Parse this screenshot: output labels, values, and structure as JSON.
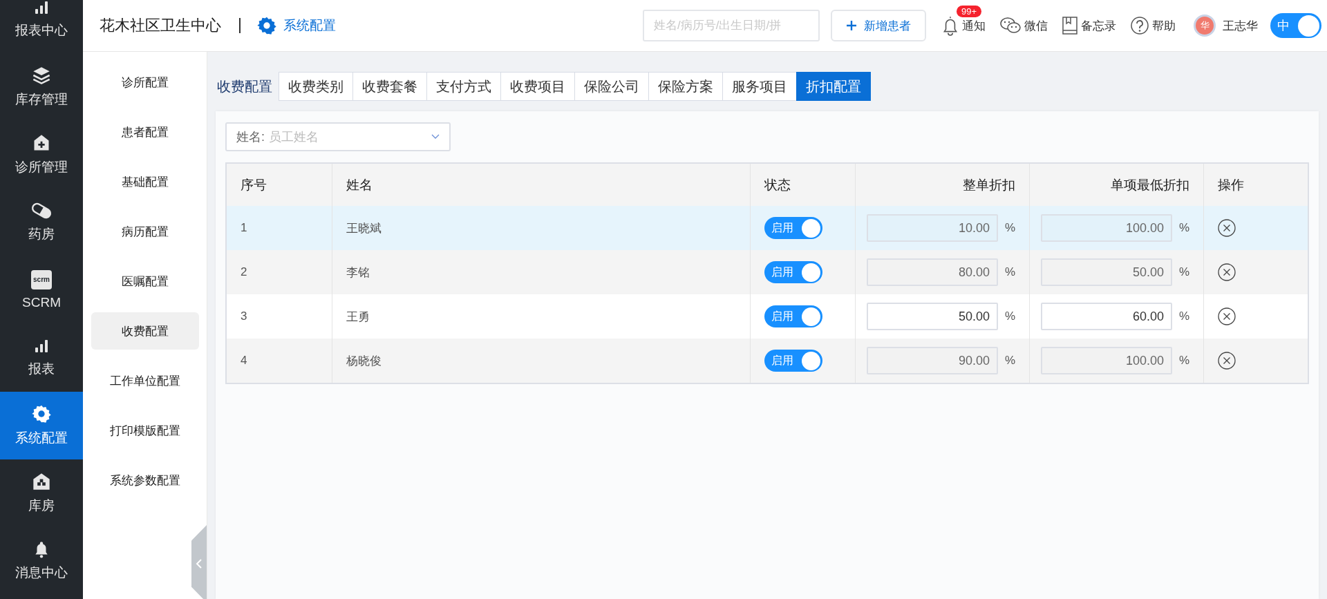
{
  "nav": {
    "items": [
      {
        "label": "报表中心",
        "kind": "bars",
        "selected": false
      },
      {
        "label": "库存管理",
        "kind": "layers",
        "selected": false
      },
      {
        "label": "诊所管理",
        "kind": "clinic",
        "selected": false
      },
      {
        "label": "药房",
        "kind": "pharmacy",
        "selected": false
      },
      {
        "label": "SCRM",
        "kind": "scrm",
        "icon_text": "scrm",
        "selected": false
      },
      {
        "label": "报表",
        "kind": "bars",
        "selected": false
      },
      {
        "label": "系统配置",
        "kind": "settings",
        "selected": true
      },
      {
        "label": "库房",
        "kind": "warehouse",
        "selected": false
      },
      {
        "label": "消息中心",
        "kind": "messages",
        "selected": false
      }
    ]
  },
  "header": {
    "clinic": "花木社区卫生中心",
    "module": "系统配置",
    "search": {
      "placeholder": "姓名/病历号/出生日期/拼"
    },
    "new_patient": "新增患者",
    "tools": [
      {
        "label": "通知",
        "kind": "notice",
        "badge": "99+"
      },
      {
        "label": "微信",
        "kind": "wechat"
      },
      {
        "label": "备忘录",
        "kind": "memo"
      },
      {
        "label": "帮助",
        "kind": "help"
      }
    ],
    "user": {
      "avatar_text": "华",
      "name": "王志华"
    },
    "lang_toggle": {
      "label": "中",
      "on": true
    }
  },
  "subnav": {
    "items": [
      {
        "label": "诊所配置",
        "selected": false
      },
      {
        "label": "患者配置",
        "selected": false
      },
      {
        "label": "基础配置",
        "selected": false
      },
      {
        "label": "病历配置",
        "selected": false
      },
      {
        "label": "医嘱配置",
        "selected": false
      },
      {
        "label": "收费配置",
        "selected": true
      },
      {
        "label": "工作单位配置",
        "selected": false
      },
      {
        "label": "打印模版配置",
        "selected": false
      },
      {
        "label": "系统参数配置",
        "selected": false
      }
    ]
  },
  "tabs": {
    "title": "收费配置",
    "items": [
      {
        "label": "收费类别",
        "selected": false
      },
      {
        "label": "收费套餐",
        "selected": false
      },
      {
        "label": "支付方式",
        "selected": false
      },
      {
        "label": "收费项目",
        "selected": false
      },
      {
        "label": "保险公司",
        "selected": false
      },
      {
        "label": "保险方案",
        "selected": false
      },
      {
        "label": "服务项目",
        "selected": false
      },
      {
        "label": "折扣配置",
        "selected": true
      }
    ]
  },
  "filter": {
    "label": "姓名:",
    "placeholder": "员工姓名"
  },
  "table": {
    "columns": [
      "序号",
      "姓名",
      "状态",
      "整单折扣",
      "单项最低折扣",
      "操作"
    ],
    "rows": [
      {
        "index": "1",
        "name": "王晓斌",
        "status": {
          "label": "启用",
          "on": true
        },
        "order_discount": {
          "value": "10.00",
          "disabled": true
        },
        "item_min_discount": {
          "value": "100.00",
          "disabled": true
        },
        "unit": "%",
        "selected": true
      },
      {
        "index": "2",
        "name": "李铭",
        "status": {
          "label": "启用",
          "on": true
        },
        "order_discount": {
          "value": "80.00",
          "disabled": true
        },
        "item_min_discount": {
          "value": "50.00",
          "disabled": true
        },
        "unit": "%",
        "selected": false
      },
      {
        "index": "3",
        "name": "王勇",
        "status": {
          "label": "启用",
          "on": true
        },
        "order_discount": {
          "value": "50.00",
          "disabled": false
        },
        "item_min_discount": {
          "value": "60.00",
          "disabled": false
        },
        "unit": "%",
        "selected": false
      },
      {
        "index": "4",
        "name": "杨晓俊",
        "status": {
          "label": "启用",
          "on": true
        },
        "order_discount": {
          "value": "90.00",
          "disabled": true
        },
        "item_min_discount": {
          "value": "100.00",
          "disabled": true
        },
        "unit": "%",
        "selected": false
      }
    ]
  }
}
